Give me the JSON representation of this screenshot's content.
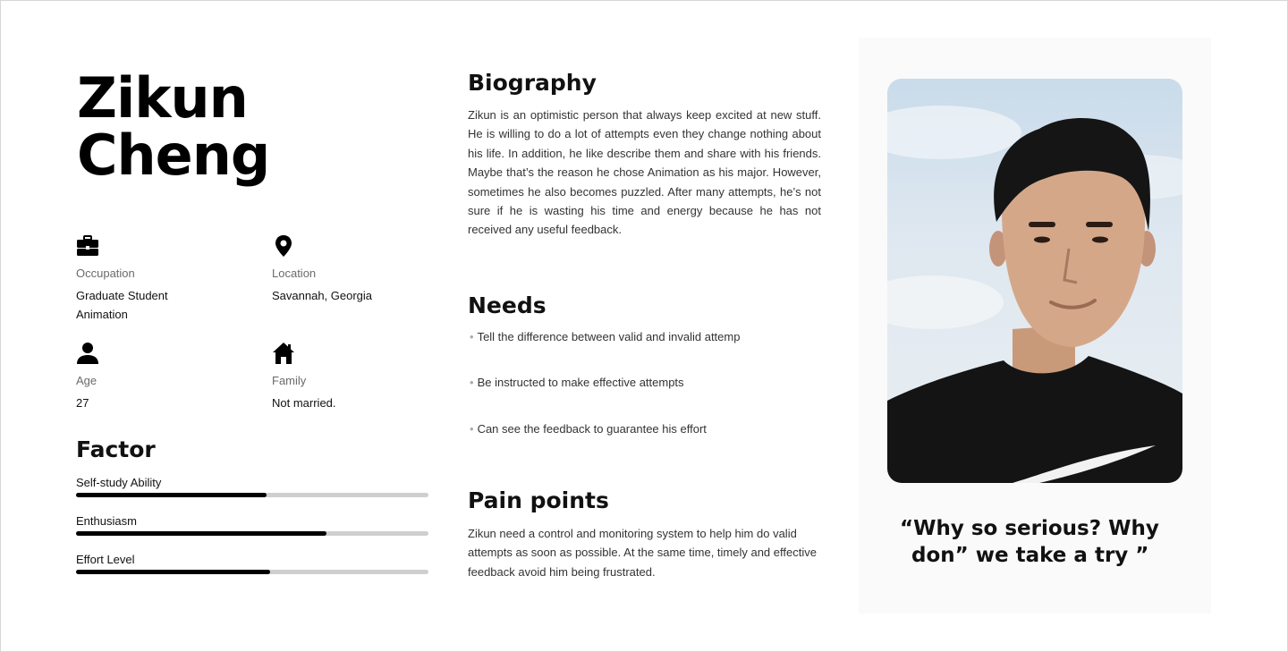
{
  "persona": {
    "first_name": "Zikun",
    "last_name": "Cheng"
  },
  "info": {
    "occupation": {
      "label": "Occupation",
      "value_line1": "Graduate Student",
      "value_line2": "Animation",
      "icon": "briefcase-icon"
    },
    "location": {
      "label": "Location",
      "value": "Savannah, Georgia",
      "icon": "location-pin-icon"
    },
    "age": {
      "label": "Age",
      "value": "27",
      "icon": "person-icon"
    },
    "family": {
      "label": "Family",
      "value": "Not married.",
      "icon": "house-icon"
    }
  },
  "factor": {
    "title": "Factor",
    "items": [
      {
        "label": "Self-study Ability",
        "level": 0.54
      },
      {
        "label": "Enthusiasm",
        "level": 0.71
      },
      {
        "label": "Effort Level",
        "level": 0.55
      }
    ]
  },
  "biography": {
    "title": "Biography",
    "text": "Zikun is an optimistic person that always keep excited at new stuff. He is willing to do a lot of attempts even they change nothing about his life. In addition, he like describe them and share with his friends. Maybe that’s the reason he chose Animation as his major. However, sometimes he also becomes puzzled. After many attempts, he’s not sure if he is wasting his time and energy because he has not received any useful feedback."
  },
  "needs": {
    "title": "Needs",
    "items": [
      "Tell the difference between valid and invalid attemp",
      "Be instructed to make effective attempts",
      "Can see the feedback to guarantee his effort"
    ]
  },
  "pain_points": {
    "title": "Pain points",
    "text": "Zikun need a control and monitoring system to help him do valid attempts as soon as possible. At the same time, timely and effective feedback avoid him being frustrated."
  },
  "quote": {
    "line1": "“Why so serious? Why",
    "line2": "don” we take a try ”"
  },
  "colors": {
    "bar_fill": "#000000",
    "bar_track": "#cfcfcf",
    "card_bg": "#fafafa"
  }
}
